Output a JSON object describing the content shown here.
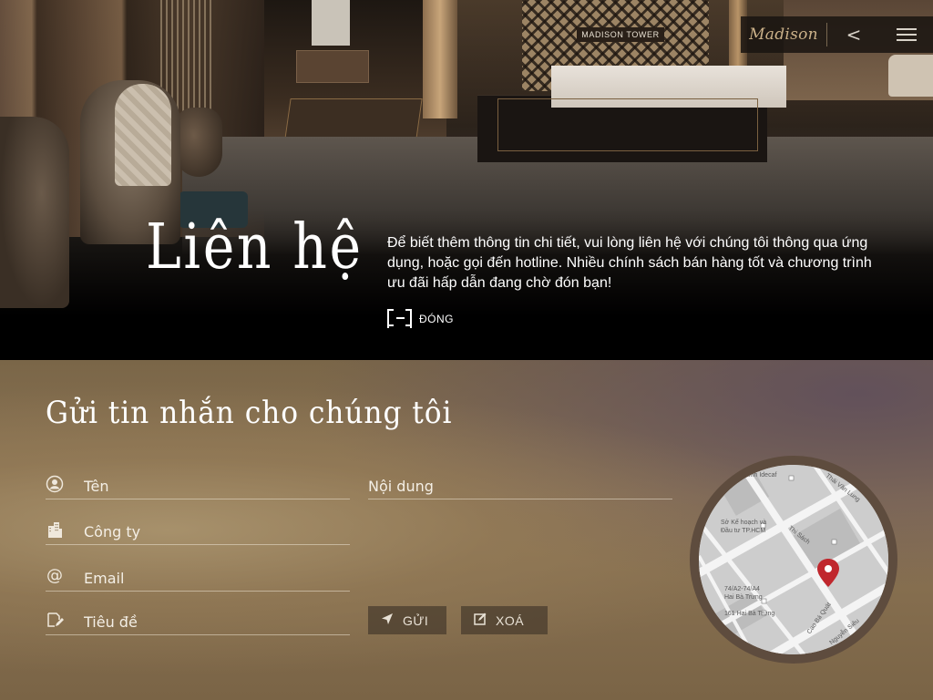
{
  "header": {
    "brand": "Madison",
    "back_label": "<"
  },
  "hero": {
    "building_sign": "MADISON TOWER",
    "title": "Liên hệ",
    "description": "Để biết thêm thông tin chi tiết, vui lòng liên hệ với chúng tôi thông qua ứng dụng, hoặc gọi đến hotline. Nhiều chính sách bán hàng tốt và chương trình ưu đãi hấp dẫn đang chờ đón bạn!",
    "close_label": "ĐÓNG"
  },
  "contact": {
    "title": "Gửi tin nhắn cho chúng tôi",
    "fields": {
      "name_placeholder": "Tên",
      "company_placeholder": "Công ty",
      "email_placeholder": "Email",
      "subject_placeholder": "Tiêu đề",
      "message_placeholder": "Nội dung"
    },
    "send_label": "GỬI",
    "clear_label": "XOÁ"
  },
  "map": {
    "labels": {
      "a": "Kính Idecaf",
      "b": "Thái Văn Lung",
      "c": "Sở Kế hoạch và",
      "d": "Đầu tư TP.HCM",
      "e": "Thi Sách",
      "f": "74/A2-74/A4",
      "g": "Hai Bà Trưng",
      "h": "161 Hai Bà Trưng",
      "i": "Cao Bá Quát",
      "j": "Nguyễn Siêu"
    },
    "pin_color": "#c0272d"
  },
  "colors": {
    "accent_gold": "#cbb189",
    "panel_brown": "#7a6648"
  }
}
